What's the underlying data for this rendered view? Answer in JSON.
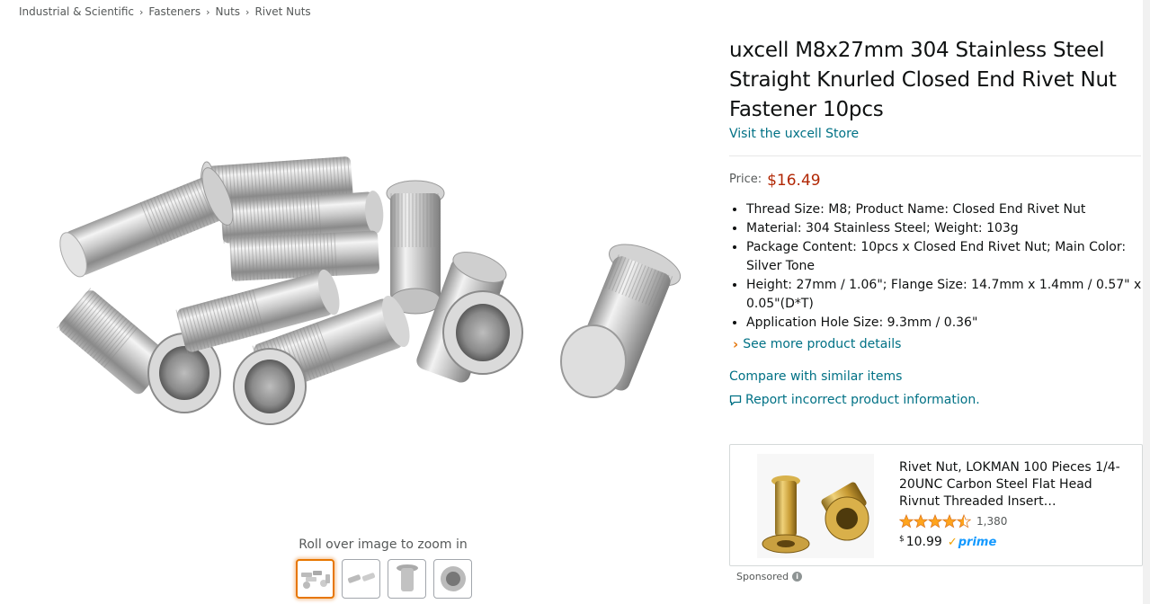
{
  "breadcrumb": [
    "Industrial & Scientific",
    "Fasteners",
    "Nuts",
    "Rivet Nuts"
  ],
  "breadcrumb_sep": "›",
  "product": {
    "title": "uxcell M8x27mm 304 Stainless Steel Straight Knurled Closed End Rivet Nut Fastener 10pcs",
    "store_link": "Visit the uxcell Store",
    "price_label": "Price:",
    "price": "$16.49",
    "bullets": [
      "Thread Size: M8; Product Name: Closed End Rivet Nut",
      "Material: 304 Stainless Steel; Weight: 103g",
      "Package Content: 10pcs x Closed End Rivet Nut; Main Color: Silver Tone",
      "Height: 27mm / 1.06\"; Flange Size: 14.7mm x 1.4mm / 0.57\" x 0.05\"(D*T)",
      "Application Hole Size: 9.3mm / 0.36\""
    ],
    "see_more": "See more product details",
    "compare": "Compare with similar items",
    "report": "Report incorrect product information."
  },
  "gallery": {
    "zoom_hint": "Roll over image to zoom in",
    "thumbnail_count": 4,
    "active_thumbnail": 0
  },
  "sponsored_ad": {
    "title": "Rivet Nut, LOKMAN 100 Pieces 1/4-20UNC Carbon Steel Flat Head Rivnut Threaded Insert…",
    "rating": 4.5,
    "rating_count": "1,380",
    "price_currency": "$",
    "price_amount": "10.99",
    "prime_label": "prime",
    "sponsored_label": "Sponsored"
  },
  "icons": {
    "breadcrumb_sep": "chevron-right-icon",
    "see_more": "chevron-right-icon",
    "report": "speech-bubble-icon",
    "info": "info-icon",
    "prime": "prime-check-icon"
  },
  "colors": {
    "link": "#007185",
    "price": "#b12704",
    "star": "#ffa41c",
    "active_thumb": "#e77600",
    "prime": "#1399ff"
  }
}
